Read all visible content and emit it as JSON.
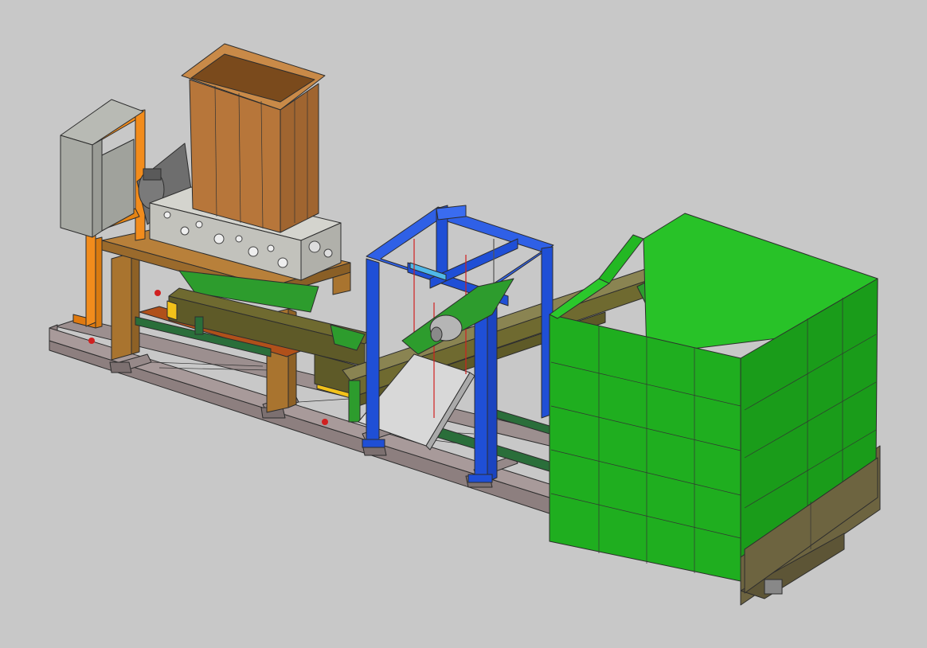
{
  "colors": {
    "background": "#c8c8c8",
    "base_frame": "#8d7f7f",
    "control_cabinet": "#a8aaa4",
    "cabinet_stand": "#f28c1c",
    "hopper": "#b7763a",
    "shredder_housing": "#c2c2bc",
    "shredder_stand": "#a9742f",
    "conveyor_belt": "#6f6a30",
    "conveyor_chute": "#2d9c2d",
    "magnet_frame": "#1f4fd6",
    "discharge_plate": "#d8d8d8",
    "container": "#1fae1f",
    "container_base": "#6d6440",
    "accent_yellow": "#f2c21a",
    "rope_red": "#d02020"
  },
  "icons": [
    "control-cabinet-icon",
    "hopper-icon",
    "shredder-icon",
    "conveyor-icon",
    "magnet-frame-icon",
    "container-icon"
  ]
}
